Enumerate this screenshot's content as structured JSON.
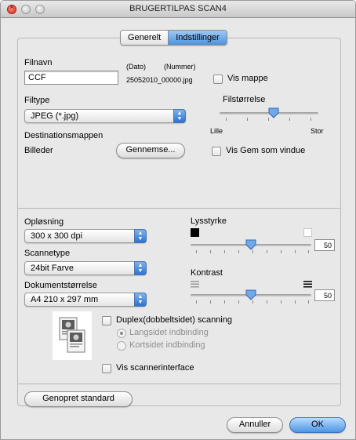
{
  "window": {
    "title": "BRUGERTILPAS SCAN4",
    "close_glyph": "×"
  },
  "tabs": [
    {
      "label": "Generelt",
      "active": false
    },
    {
      "label": "Indstillinger",
      "active": true
    }
  ],
  "file": {
    "name_label": "Filnavn",
    "name_value": "CCF",
    "date_label": "(Dato)",
    "number_label": "(Nummer)",
    "generated_name": "25052010_00000.jpg",
    "show_folder_label": "Vis mappe",
    "show_folder_checked": false
  },
  "filetype": {
    "label": "Filtype",
    "value": "JPEG (*.jpg)"
  },
  "filesize": {
    "label": "Filstørrelse",
    "min_label": "Lille",
    "max_label": "Stor",
    "level_percent": 55
  },
  "destination": {
    "label": "Destinationsmappen",
    "folder": "Billeder",
    "browse_label": "Gennemse...",
    "save_as_window_label": "Vis Gem som vindue",
    "save_as_window_checked": false
  },
  "resolution": {
    "label": "Opløsning",
    "value": "300 x 300 dpi"
  },
  "scantype": {
    "label": "Scannetype",
    "value": "24bit Farve"
  },
  "docsize": {
    "label": "Dokumentstørrelse",
    "value": "A4  210 x 297 mm"
  },
  "brightness": {
    "label": "Lysstyrke",
    "value": "50",
    "level_percent": 50
  },
  "contrast": {
    "label": "Kontrast",
    "value": "50",
    "level_percent": 50
  },
  "duplex": {
    "label": "Duplex(dobbeltsidet) scanning",
    "checked": false,
    "long_edge_label": "Langsidet indbinding",
    "short_edge_label": "Kortsidet indbinding",
    "selected": "long_edge"
  },
  "scanner_interface": {
    "label": "Vis scannerinterface",
    "checked": false
  },
  "buttons": {
    "restore_default": "Genopret standard",
    "cancel": "Annuller",
    "ok": "OK"
  },
  "colors": {
    "accent": "#4f92dc",
    "close_button": "#d0281c"
  },
  "icons": {
    "brightness_low": "black-square-icon",
    "brightness_high": "white-square-icon",
    "contrast_low": "low-contrast-lines-icon",
    "contrast_high": "high-contrast-lines-icon",
    "duplex_preview": "duplex-document-icon"
  }
}
